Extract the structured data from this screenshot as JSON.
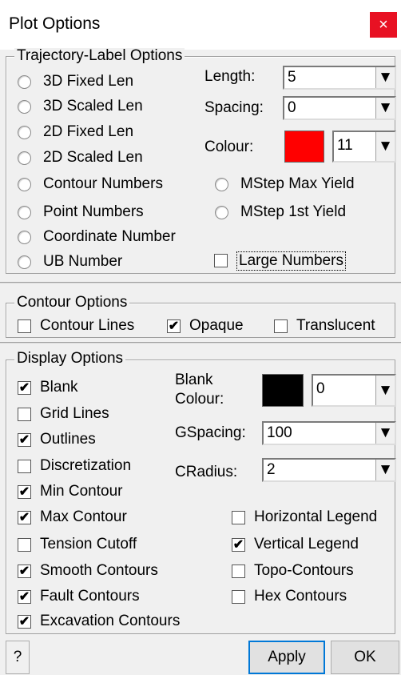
{
  "window": {
    "title": "Plot Options",
    "close_glyph": "×"
  },
  "trajectory": {
    "legend": "Trajectory-Label Options",
    "radios": [
      "3D Fixed Len",
      "3D Scaled Len",
      "2D Fixed Len",
      "2D Scaled Len",
      "Contour Numbers",
      "Point Numbers",
      "Coordinate Number",
      "UB Number"
    ],
    "mstep_radios": [
      "MStep Max Yield",
      "MStep 1st Yield"
    ],
    "length_label": "Length:",
    "length_value": "5",
    "spacing_label": "Spacing:",
    "spacing_value": "0",
    "colour_label": "Colour:",
    "colour_value": "11",
    "colour_swatch": "#ff0000",
    "large_numbers": {
      "label": "Large Numbers",
      "checked": false
    }
  },
  "contour": {
    "legend": "Contour Options",
    "items": [
      {
        "label": "Contour Lines",
        "checked": false
      },
      {
        "label": "Opaque",
        "checked": true
      },
      {
        "label": "Translucent",
        "checked": false
      }
    ]
  },
  "display": {
    "legend": "Display Options",
    "left_checks": [
      {
        "label": "Blank",
        "checked": true
      },
      {
        "label": "Grid Lines",
        "checked": false
      },
      {
        "label": "Outlines",
        "checked": true
      },
      {
        "label": "Discretization",
        "checked": false
      },
      {
        "label": "Min Contour",
        "checked": true
      },
      {
        "label": "Max Contour",
        "checked": true
      },
      {
        "label": "Tension Cutoff",
        "checked": false
      },
      {
        "label": "Smooth Contours",
        "checked": true
      },
      {
        "label": "Fault Contours",
        "checked": true
      },
      {
        "label": "Excavation Contours",
        "checked": true
      }
    ],
    "right_checks": [
      {
        "label": "Horizontal Legend",
        "checked": false
      },
      {
        "label": "Vertical Legend",
        "checked": true
      },
      {
        "label": "Topo-Contours",
        "checked": false
      },
      {
        "label": "Hex Contours",
        "checked": false
      }
    ],
    "blank_colour_label_1": "Blank",
    "blank_colour_label_2": "Colour:",
    "blank_colour_value": "0",
    "blank_colour_swatch": "#000000",
    "gspacing_label": "GSpacing:",
    "gspacing_value": "100",
    "cradius_label": "CRadius:",
    "cradius_value": "2"
  },
  "footer": {
    "help_label": "?",
    "apply_label": "Apply",
    "ok_label": "OK"
  },
  "check_mark": "✔",
  "arrow_glyph": "▼"
}
